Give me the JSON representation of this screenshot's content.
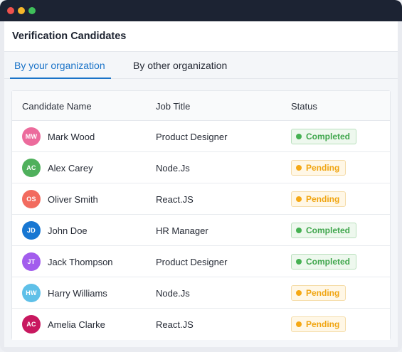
{
  "window": {
    "colors": {
      "titlebar": "#1c2333",
      "close": "#f0524d",
      "minimize": "#f5b62a",
      "maximize": "#3fbf5a"
    }
  },
  "panel": {
    "title": "Verification Candidates",
    "tabs": [
      {
        "label": "By your organization",
        "active": true
      },
      {
        "label": "By other organization",
        "active": false
      }
    ]
  },
  "table": {
    "headers": [
      "Candidate Name",
      "Job Title",
      "Status"
    ],
    "rows": [
      {
        "initials": "MW",
        "avatar_color": "#ec6b9c",
        "name": "Mark Wood",
        "job": "Product Designer",
        "status": "Completed"
      },
      {
        "initials": "AC",
        "avatar_color": "#4fb05c",
        "name": "Alex Carey",
        "job": "Node.Js",
        "status": "Pending"
      },
      {
        "initials": "OS",
        "avatar_color": "#f26b5f",
        "name": "Oliver Smith",
        "job": "React.JS",
        "status": "Pending"
      },
      {
        "initials": "JD",
        "avatar_color": "#1877d2",
        "name": "John Doe",
        "job": "HR Manager",
        "status": "Completed"
      },
      {
        "initials": "JT",
        "avatar_color": "#a25ded",
        "name": "Jack Thompson",
        "job": "Product Designer",
        "status": "Completed"
      },
      {
        "initials": "HW",
        "avatar_color": "#5fc0e8",
        "name": "Harry Williams",
        "job": "Node.Js",
        "status": "Pending"
      },
      {
        "initials": "AC",
        "avatar_color": "#c8185f",
        "name": "Amelia Clarke",
        "job": "React.JS",
        "status": "Pending"
      }
    ],
    "status_colors": {
      "Completed": "#3fa64c",
      "Pending": "#f0a512"
    }
  }
}
